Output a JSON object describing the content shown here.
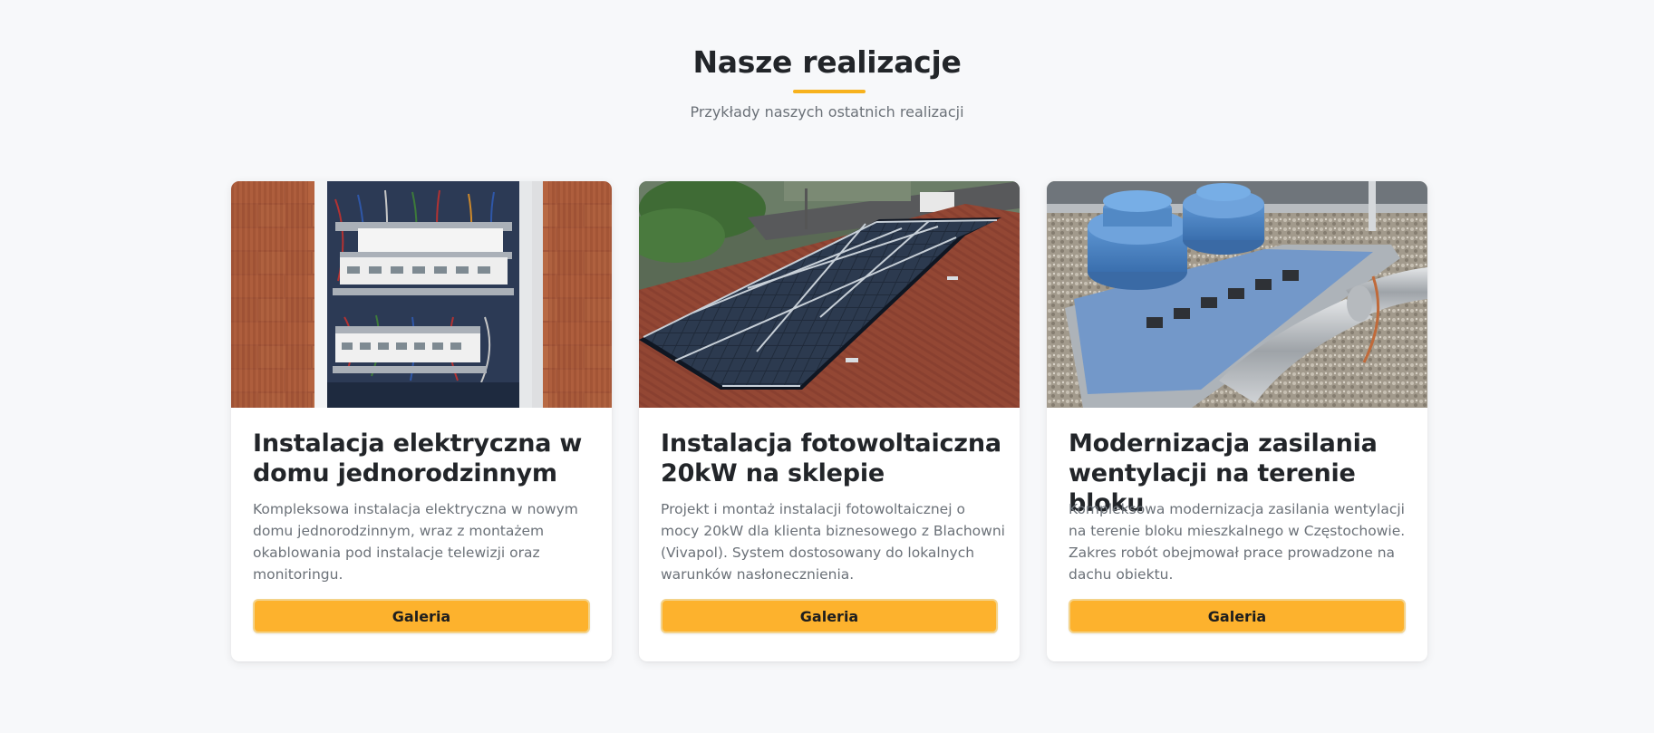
{
  "section": {
    "title": "Nasze realizacje",
    "subtitle": "Przykłady naszych ostatnich realizacji"
  },
  "colors": {
    "accent": "#f7b21e",
    "button": "#fdb22d",
    "background": "#f7f8fa",
    "card": "#ffffff",
    "text_primary": "#222529",
    "text_secondary": "#6b7178"
  },
  "projects": [
    {
      "image_icon": "electrical-panel-photo",
      "title": "Instalacja elektryczna w domu jednorodzinnym",
      "description": "Kompleksowa instalacja elektryczna w nowym domu jednorodzinnym, wraz z montażem okablowania pod instalacje telewizji oraz monitoringu.",
      "button_label": "Galeria"
    },
    {
      "image_icon": "solar-panels-roof-photo",
      "title": "Instalacja fotowoltaiczna 20kW na sklepie",
      "description": "Projekt i montaż instalacji fotowoltaicznej o mocy 20kW dla klienta biznesowego z Blachowni (Vivapol). System dostosowany do lokalnych warunków nasłonecznienia.",
      "button_label": "Galeria"
    },
    {
      "image_icon": "ventilation-fans-roof-photo",
      "title": "Modernizacja zasilania wentylacji na terenie bloku",
      "description": "Kompleksowa modernizacja zasilania wentylacji na terenie bloku mieszkalnego w Częstochowie. Zakres robót obejmował prace prowadzone na dachu obiektu.",
      "button_label": "Galeria"
    }
  ]
}
